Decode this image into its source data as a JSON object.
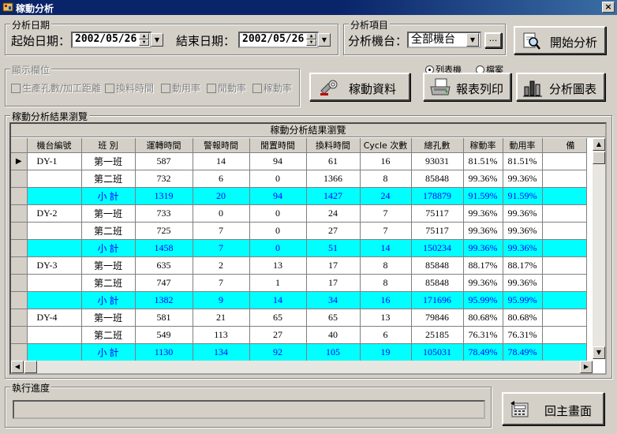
{
  "window": {
    "title": "稼動分析",
    "close": "×"
  },
  "date_group": {
    "legend": "分析日期",
    "start_label": "起始日期：",
    "start_value": "2002/05/26",
    "end_label": "結束日期：",
    "end_value": "2002/05/26"
  },
  "item_group": {
    "legend": "分析項目",
    "machine_label": "分析機台：",
    "machine_value": "全部機台",
    "browse_label": "..."
  },
  "buttons": {
    "start": "開始分析",
    "data": "稼動資料",
    "print": "報表列印",
    "chart": "分析圖表",
    "back": "回主畫面"
  },
  "display_group": {
    "legend": "顯示欄位",
    "options": [
      "生產孔數/加工距離",
      "換料時間",
      "動用率",
      "閒動率",
      "稼動率"
    ]
  },
  "output_mode": {
    "options": [
      "列表機",
      "檔案"
    ],
    "selected": 0
  },
  "result_group": {
    "legend": "稼動分析結果瀏覽"
  },
  "grid": {
    "caption": "稼動分析結果瀏覽",
    "columns": [
      "機台編號",
      "班 別",
      "運轉時間",
      "警報時間",
      "閒置時間",
      "換料時間",
      "Cycle 次數",
      "總孔數",
      "稼動率",
      "動用率",
      "備"
    ],
    "rows": [
      {
        "cells": [
          "DY-1",
          "第一班",
          "587",
          "14",
          "94",
          "61",
          "16",
          "93031",
          "81.51%",
          "81.51%",
          ""
        ],
        "subtotal": false,
        "current": true
      },
      {
        "cells": [
          "",
          "第二班",
          "732",
          "6",
          "0",
          "1366",
          "8",
          "85848",
          "99.36%",
          "99.36%",
          ""
        ],
        "subtotal": false,
        "current": false
      },
      {
        "cells": [
          "",
          "小 計",
          "1319",
          "20",
          "94",
          "1427",
          "24",
          "178879",
          "91.59%",
          "91.59%",
          ""
        ],
        "subtotal": true,
        "current": false
      },
      {
        "cells": [
          "DY-2",
          "第一班",
          "733",
          "0",
          "0",
          "24",
          "7",
          "75117",
          "99.36%",
          "99.36%",
          ""
        ],
        "subtotal": false,
        "current": false
      },
      {
        "cells": [
          "",
          "第二班",
          "725",
          "7",
          "0",
          "27",
          "7",
          "75117",
          "99.36%",
          "99.36%",
          ""
        ],
        "subtotal": false,
        "current": false
      },
      {
        "cells": [
          "",
          "小 計",
          "1458",
          "7",
          "0",
          "51",
          "14",
          "150234",
          "99.36%",
          "99.36%",
          ""
        ],
        "subtotal": true,
        "current": false
      },
      {
        "cells": [
          "DY-3",
          "第一班",
          "635",
          "2",
          "13",
          "17",
          "8",
          "85848",
          "88.17%",
          "88.17%",
          ""
        ],
        "subtotal": false,
        "current": false
      },
      {
        "cells": [
          "",
          "第二班",
          "747",
          "7",
          "1",
          "17",
          "8",
          "85848",
          "99.36%",
          "99.36%",
          ""
        ],
        "subtotal": false,
        "current": false
      },
      {
        "cells": [
          "",
          "小 計",
          "1382",
          "9",
          "14",
          "34",
          "16",
          "171696",
          "95.99%",
          "95.99%",
          ""
        ],
        "subtotal": true,
        "current": false
      },
      {
        "cells": [
          "DY-4",
          "第一班",
          "581",
          "21",
          "65",
          "65",
          "13",
          "79846",
          "80.68%",
          "80.68%",
          ""
        ],
        "subtotal": false,
        "current": false
      },
      {
        "cells": [
          "",
          "第二班",
          "549",
          "113",
          "27",
          "40",
          "6",
          "25185",
          "76.31%",
          "76.31%",
          ""
        ],
        "subtotal": false,
        "current": false
      },
      {
        "cells": [
          "",
          "小 計",
          "1130",
          "134",
          "92",
          "105",
          "19",
          "105031",
          "78.49%",
          "78.49%",
          ""
        ],
        "subtotal": true,
        "current": false
      }
    ]
  },
  "progress_group": {
    "legend": "執行進度"
  },
  "colors": {
    "titlebar": "#0a246a",
    "subtotal_bg": "#00ffff",
    "subtotal_fg": "#0000ff",
    "face": "#d4d0c8"
  }
}
